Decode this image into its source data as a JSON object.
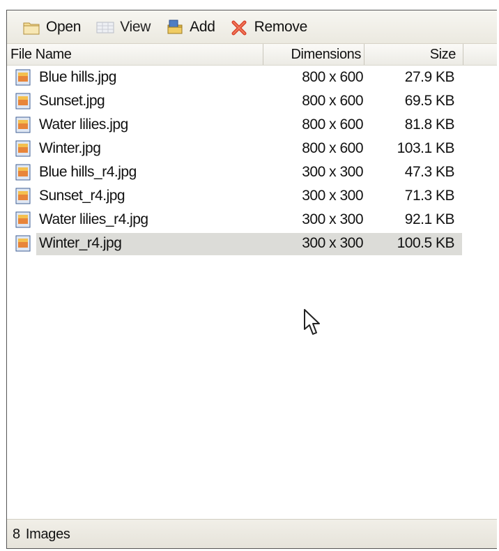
{
  "toolbar": {
    "open_label": "Open",
    "view_label": "View",
    "add_label": "Add",
    "remove_label": "Remove"
  },
  "columns": {
    "name": "File Name",
    "dimensions": "Dimensions",
    "size": "Size"
  },
  "files": [
    {
      "name": "Blue hills.jpg",
      "dimensions": "800 x 600",
      "size": "27.9 KB"
    },
    {
      "name": "Sunset.jpg",
      "dimensions": "800 x 600",
      "size": "69.5 KB"
    },
    {
      "name": "Water lilies.jpg",
      "dimensions": "800 x 600",
      "size": "81.8 KB"
    },
    {
      "name": "Winter.jpg",
      "dimensions": "800 x 600",
      "size": "103.1 KB"
    },
    {
      "name": "Blue hills_r4.jpg",
      "dimensions": "300 x 300",
      "size": "47.3 KB"
    },
    {
      "name": "Sunset_r4.jpg",
      "dimensions": "300 x 300",
      "size": "71.3 KB"
    },
    {
      "name": "Water lilies_r4.jpg",
      "dimensions": "300 x 300",
      "size": "92.1 KB"
    },
    {
      "name": "Winter_r4.jpg",
      "dimensions": "300 x 300",
      "size": "100.5 KB",
      "selected": true
    }
  ],
  "status": {
    "count": "8",
    "label": "Images"
  },
  "icons": {
    "open": "folder-open-icon",
    "view": "view-grid-icon",
    "add": "add-folder-icon",
    "remove": "remove-x-icon",
    "file": "image-file-icon",
    "cursor": "mouse-pointer-icon"
  },
  "colors": {
    "selection": "#dcdcd8",
    "remove_red": "#d9412a",
    "toolbar_bg": "#efede5"
  }
}
